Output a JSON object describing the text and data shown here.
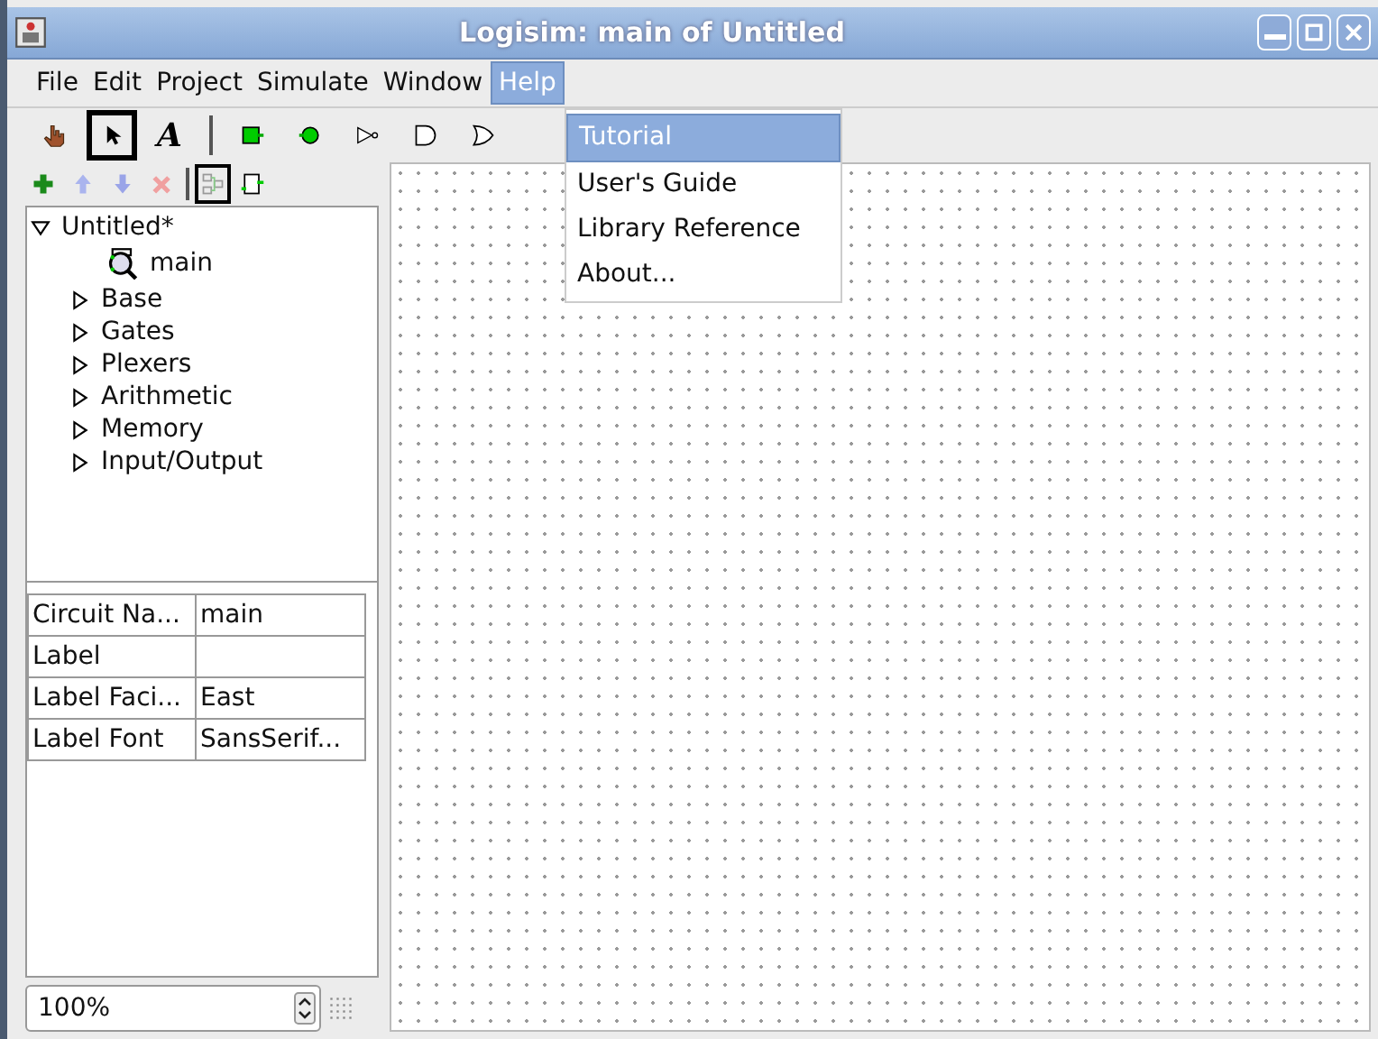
{
  "window": {
    "title": "Logisim: main of Untitled"
  },
  "menu_bar": [
    {
      "label": "File",
      "selected": false
    },
    {
      "label": "Edit",
      "selected": false
    },
    {
      "label": "Project",
      "selected": false
    },
    {
      "label": "Simulate",
      "selected": false
    },
    {
      "label": "Window",
      "selected": false
    },
    {
      "label": "Help",
      "selected": true
    }
  ],
  "open_menu": {
    "items": [
      {
        "label": "Tutorial",
        "selected": true
      },
      {
        "label": "User's Guide",
        "selected": false
      },
      {
        "label": "Library Reference",
        "selected": false
      },
      {
        "label": "About...",
        "selected": false
      }
    ]
  },
  "tools": [
    {
      "kind": "hand",
      "selected": false
    },
    {
      "kind": "pointer",
      "selected": true
    },
    {
      "kind": "text",
      "label": "A",
      "selected": false
    },
    {
      "kind": "separator"
    },
    {
      "kind": "input-pin",
      "selected": false
    },
    {
      "kind": "output-pin",
      "selected": false
    },
    {
      "kind": "not-gate",
      "selected": false
    },
    {
      "kind": "and-gate",
      "selected": false
    },
    {
      "kind": "or-gate",
      "selected": false
    }
  ],
  "project_tools": [
    {
      "kind": "add",
      "disabled": false
    },
    {
      "kind": "up",
      "disabled": true
    },
    {
      "kind": "down",
      "disabled": true
    },
    {
      "kind": "delete",
      "disabled": true
    },
    {
      "kind": "separator"
    },
    {
      "kind": "layout-view",
      "selected": true
    },
    {
      "kind": "appearance-view",
      "selected": false
    }
  ],
  "tree": [
    {
      "label": "Untitled*",
      "expanded": true,
      "children": [
        {
          "label": "main",
          "kind": "circuit"
        },
        {
          "label": "Base",
          "expanded": false
        },
        {
          "label": "Gates",
          "expanded": false
        },
        {
          "label": "Plexers",
          "expanded": false
        },
        {
          "label": "Arithmetic",
          "expanded": false
        },
        {
          "label": "Memory",
          "expanded": false
        },
        {
          "label": "Input/Output",
          "expanded": false
        }
      ]
    }
  ],
  "attributes": [
    {
      "name": "Circuit Na...",
      "value": "main"
    },
    {
      "name": "Label"
    },
    {
      "name": "Label Faci...",
      "value": "East"
    },
    {
      "name": "Label Font",
      "value": "SansSerif..."
    }
  ],
  "zoom": {
    "value": "100%"
  }
}
